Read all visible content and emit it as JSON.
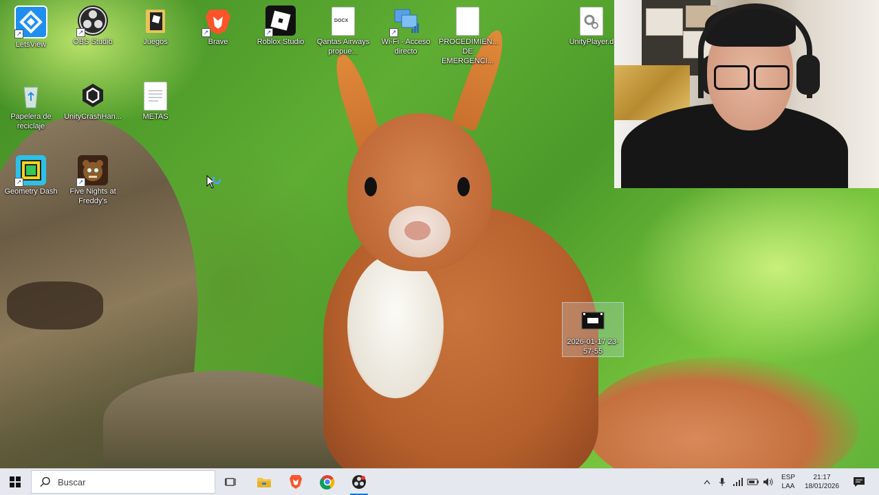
{
  "desktop": {
    "icons": [
      {
        "label": "LetsView",
        "icon": "letsview-icon"
      },
      {
        "label": "OBS Studio",
        "icon": "obs-icon"
      },
      {
        "label": "Juegos",
        "icon": "folder-icon"
      },
      {
        "label": "Brave",
        "icon": "brave-icon"
      },
      {
        "label": "Roblox Studio",
        "icon": "roblox-studio-icon"
      },
      {
        "label": "Qantas Airways propue...",
        "icon": "docx-file-icon",
        "badge": "DOCX"
      },
      {
        "label": "Wi-Fi - Acceso directo",
        "icon": "wifi-settings-icon"
      },
      {
        "label": "PROCEDIMIEN... DE EMERGENCI...",
        "icon": "file-icon"
      },
      {
        "label": "UnityPlayer.d",
        "icon": "dll-file-icon"
      },
      {
        "label": "Papelera de reciclaje",
        "icon": "recycle-bin-icon"
      },
      {
        "label": "UnityCrashHan...",
        "icon": "unity-icon"
      },
      {
        "label": "METAS",
        "icon": "text-file-icon"
      },
      {
        "label": "Geometry Dash",
        "icon": "geometry-dash-icon"
      },
      {
        "label": "Five Nights at Freddy's",
        "icon": "fnaf-icon"
      },
      {
        "label": "2026-01-17 23-57-55",
        "icon": "video-file-icon"
      }
    ]
  },
  "taskbar": {
    "search_placeholder": "Buscar",
    "language_primary": "ESP",
    "language_secondary": "LAA",
    "time": "21:17",
    "date": "18/01/2026"
  },
  "colors": {
    "taskbar_bg": "#e5e9ef",
    "accent": "#0078d4"
  }
}
